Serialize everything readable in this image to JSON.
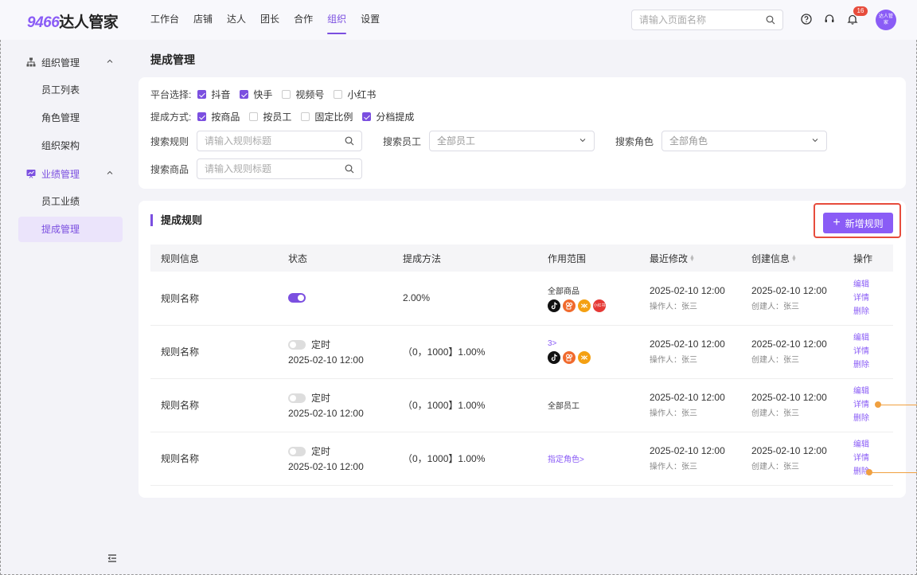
{
  "header": {
    "logo_num": "9466",
    "logo_text": "达人管家",
    "nav": [
      "工作台",
      "店铺",
      "达人",
      "团长",
      "合作",
      "组织",
      "设置"
    ],
    "active_nav": 5,
    "search_placeholder": "请输入页面名称",
    "notification_count": "16",
    "avatar_text": "达人管家"
  },
  "sidebar": {
    "group1": "组织管理",
    "group1_items": [
      "员工列表",
      "角色管理",
      "组织架构"
    ],
    "group2": "业绩管理",
    "group2_items": [
      "员工业绩",
      "提成管理"
    ]
  },
  "page_title": "提成管理",
  "filters": {
    "platform_label": "平台选择:",
    "platforms": [
      {
        "label": "抖音",
        "checked": true
      },
      {
        "label": "快手",
        "checked": true
      },
      {
        "label": "视频号",
        "checked": false
      },
      {
        "label": "小红书",
        "checked": false
      }
    ],
    "method_label": "提成方式:",
    "methods": [
      {
        "label": "按商品",
        "checked": true
      },
      {
        "label": "按员工",
        "checked": false
      },
      {
        "label": "固定比例",
        "checked": false
      },
      {
        "label": "分档提成",
        "checked": true
      }
    ],
    "search_rule_label": "搜索规则",
    "search_rule_placeholder": "请输入规则标题",
    "search_staff_label": "搜索员工",
    "search_staff_value": "全部员工",
    "search_role_label": "搜索角色",
    "search_role_value": "全部角色",
    "search_goods_label": "搜索商品",
    "search_goods_placeholder": "请输入规则标题"
  },
  "rules": {
    "title": "提成规则",
    "add_label": "新增规则",
    "columns": [
      "规则信息",
      "状态",
      "提成方法",
      "作用范围",
      "最近修改",
      "创建信息",
      "操作"
    ],
    "rows": [
      {
        "name": "规则名称",
        "enabled": true,
        "timer": "",
        "timer_time": "",
        "method": "2.00%",
        "scope_label": "全部商品",
        "scope_link": "",
        "platforms": [
          "douyin",
          "kuaishou",
          "wechat",
          "xhs"
        ],
        "modified": "2025-02-10 12:00",
        "modifier": "操作人：张三",
        "created": "2025-02-10 12:00",
        "creator": "创建人：张三"
      },
      {
        "name": "规则名称",
        "enabled": false,
        "timer": "定时",
        "timer_time": "2025-02-10 12:00",
        "method": "（0，1000】1.00%",
        "scope_label": "",
        "scope_link": "3>",
        "platforms": [
          "douyin",
          "kuaishou",
          "wechat"
        ],
        "modified": "2025-02-10 12:00",
        "modifier": "操作人：张三",
        "created": "2025-02-10 12:00",
        "creator": "创建人：张三"
      },
      {
        "name": "规则名称",
        "enabled": false,
        "timer": "定时",
        "timer_time": "2025-02-10 12:00",
        "method": "（0，1000】1.00%",
        "scope_label": "全部员工",
        "scope_link": "",
        "platforms": [],
        "modified": "2025-02-10 12:00",
        "modifier": "操作人：张三",
        "created": "2025-02-10 12:00",
        "creator": "创建人：张三"
      },
      {
        "name": "规则名称",
        "enabled": false,
        "timer": "定时",
        "timer_time": "2025-02-10 12:00",
        "method": "（0，1000】1.00%",
        "scope_label": "",
        "scope_link": "指定角色>",
        "platforms": [],
        "modified": "2025-02-10 12:00",
        "modifier": "操作人：张三",
        "created": "2025-02-10 12:00",
        "creator": "创建人：张三"
      }
    ],
    "ops": [
      "编辑",
      "详情",
      "删除"
    ],
    "platform_icon_text": {
      "douyin": "",
      "kuaishou": "",
      "wechat": "",
      "xhs": "小红书"
    }
  },
  "colors": {
    "accent": "#7b4fe0",
    "highlight": "#e74c3c",
    "annotation": "#f0a040"
  }
}
